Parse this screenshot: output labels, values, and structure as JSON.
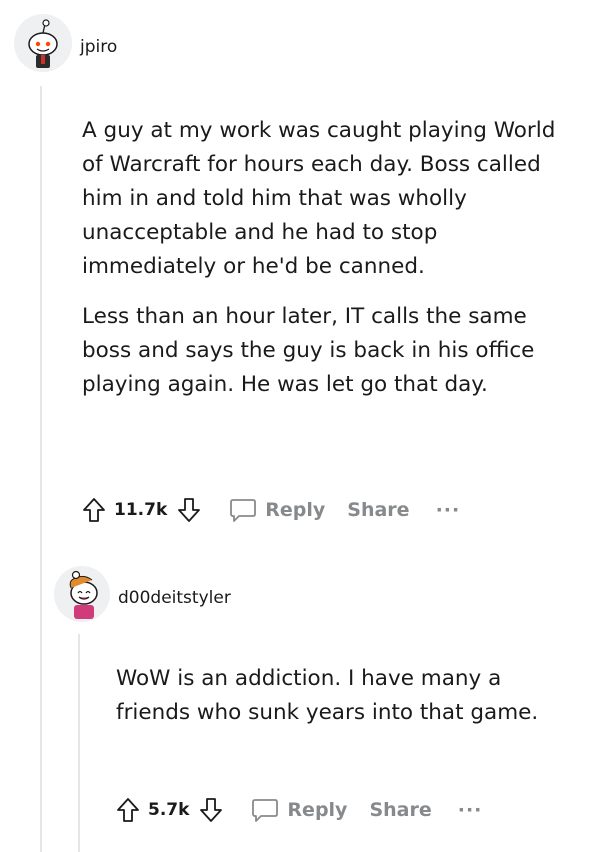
{
  "comments": [
    {
      "username": "jpiro",
      "paragraphs": [
        "A guy at my work was caught playing World of Warcraft for hours each day. Boss called him in and told him that was wholly unacceptable and he had to stop immediately or he'd be canned.",
        "Less than an hour later, IT calls the same boss and says the guy is back in his office playing again. He was let go that day."
      ],
      "score": "11.7k",
      "reply_label": "Reply",
      "share_label": "Share",
      "more_label": "···"
    },
    {
      "username": "d00deitstyler",
      "paragraphs": [
        "WoW is an addiction. I have many a friends who sunk years into that game."
      ],
      "score": "5.7k",
      "reply_label": "Reply",
      "share_label": "Share",
      "more_label": "···"
    }
  ],
  "icons": {
    "upvote": "arrow-up-icon",
    "downvote": "arrow-down-icon",
    "reply": "speech-bubble-icon",
    "more": "ellipsis-icon"
  },
  "colors": {
    "text": "#1a1a1b",
    "muted": "#878a8c",
    "thread_line": "#e6e6e6"
  }
}
